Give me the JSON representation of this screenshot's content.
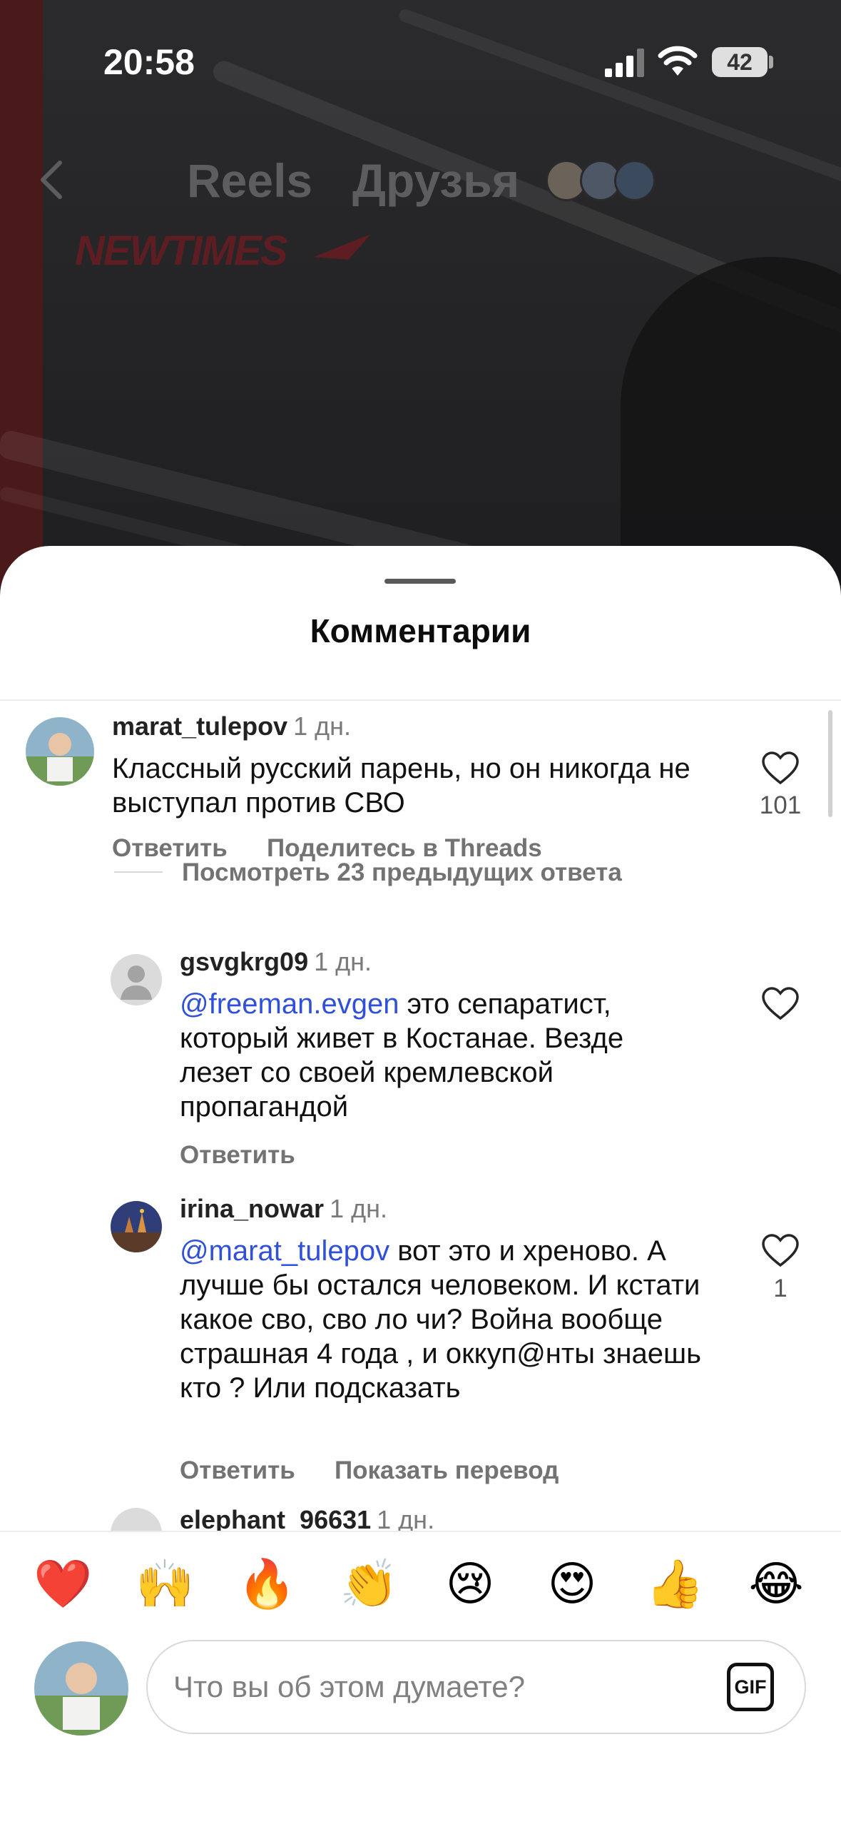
{
  "status_bar": {
    "time": "20:58",
    "battery": "42"
  },
  "nav": {
    "tabs": [
      {
        "label": "Reels"
      },
      {
        "label": "Друзья"
      }
    ]
  },
  "video": {
    "logo_text": "NEWTIMES"
  },
  "sheet": {
    "title": "Комментарии",
    "comments": [
      {
        "username": "marat_tulepov",
        "time": "1 дн.",
        "text": "Классный русский парень, но он никогда не выступал против СВО",
        "likes": "101",
        "actions": [
          "Ответить",
          "Поделитесь в Threads"
        ],
        "view_replies": "Посмотреть 23 предыдущих ответа"
      },
      {
        "username": "gsvgkrg09",
        "time": "1 дн.",
        "mention": "@freeman.evgen",
        "text": " это сепаратист, который живет в Костанае. Везде лезет со своей кремлевской пропагандой",
        "actions": [
          "Ответить"
        ]
      },
      {
        "username": "irina_nowar",
        "time": "1 дн.",
        "mention": "@marat_tulepov",
        "text": " вот это и хреново. А лучше бы остался человеком. И кстати какое сво, сво ло чи? Война вообще страшная 4 года , и оккуп@нты знаешь кто ? Или подсказать",
        "likes": "1",
        "actions": [
          "Ответить",
          "Показать перевод"
        ]
      },
      {
        "username": "elephant_96631",
        "time": "1 дн."
      }
    ]
  },
  "emoji_bar": [
    "❤️",
    "🙌",
    "🔥",
    "👏",
    "😢",
    "😍",
    "👍",
    "😂"
  ],
  "input": {
    "placeholder": "Что вы об этом думаете?",
    "gif_label": "GIF"
  }
}
